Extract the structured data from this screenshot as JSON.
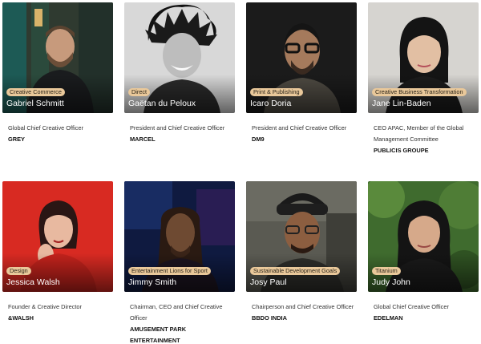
{
  "people": [
    {
      "badge": "Creative Commerce",
      "name": "Gabriel Schmitt",
      "role": "Global Chief Creative Officer",
      "company": "GREY"
    },
    {
      "badge": "Direct",
      "name": "Gaëtan du Peloux",
      "role": "President and Chief Creative Officer",
      "company": "MARCEL"
    },
    {
      "badge": "Print & Publishing",
      "name": "Icaro Doria",
      "role": "President and Chief Creative Officer",
      "company": "DM9"
    },
    {
      "badge": "Creative Business Transformation",
      "name": "Jane Lin-Baden",
      "role": "CEO APAC, Member of the Global Management Committee",
      "company": "PUBLICIS GROUPE"
    },
    {
      "badge": "Design",
      "name": "Jessica Walsh",
      "role": "Founder & Creative Director",
      "company": "&WALSH"
    },
    {
      "badge": "Entertainment Lions for Sport",
      "name": "Jimmy Smith",
      "role": "Chairman, CEO and Chief Creative Officer",
      "company": "AMUSEMENT PARK ENTERTAINMENT"
    },
    {
      "badge": "Sustainable Development Goals",
      "name": "Josy Paul",
      "role": "Chairperson and Chief Creative Officer",
      "company": "BBDO INDIA"
    },
    {
      "badge": "Titanium",
      "name": "Judy John",
      "role": "Global Chief Creative Officer",
      "company": "EDELMAN"
    }
  ],
  "colors": {
    "badge_bg": "#e9c89a",
    "name_text": "#ffffff"
  }
}
